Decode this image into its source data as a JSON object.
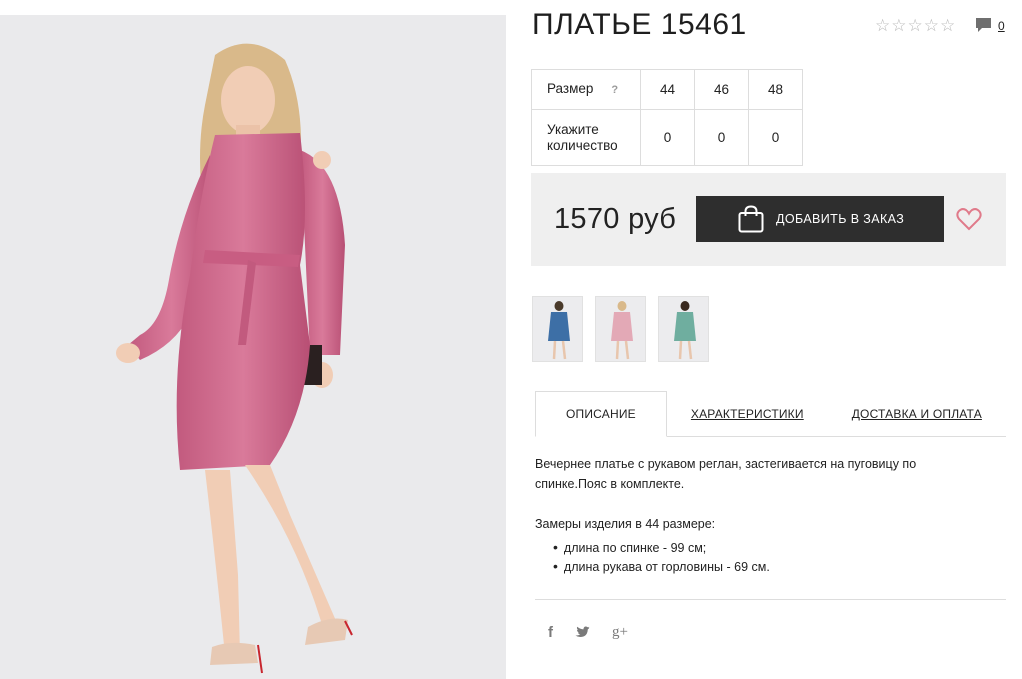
{
  "product": {
    "title": "ПЛАТЬЕ 15461",
    "rating_stars": 5,
    "rating_value": 0,
    "comments_count": "0",
    "price": "1570 руб",
    "add_to_order_label": "ДОБАВИТЬ В ЗАКАЗ",
    "accent_color": "#e07a8a"
  },
  "size_table": {
    "size_label": "Размер",
    "help_mark": "?",
    "qty_label": "Укажите количество",
    "sizes": [
      "44",
      "46",
      "48"
    ],
    "quantities": [
      "0",
      "0",
      "0"
    ]
  },
  "thumbnails": [
    {
      "color_name": "blue",
      "color": "#3d6fa6"
    },
    {
      "color_name": "pink",
      "color": "#e3a9b6"
    },
    {
      "color_name": "mint",
      "color": "#6fae9f"
    }
  ],
  "tabs": [
    {
      "label": "ОПИСАНИЕ",
      "active": true
    },
    {
      "label": "ХАРАКТЕРИСТИКИ",
      "active": false
    },
    {
      "label": "ДОСТАВКА И ОПЛАТА",
      "active": false
    }
  ],
  "description": {
    "text": "Вечернее платье с рукавом реглан, застегивается на пуговицу по спинке.Пояс в комплекте.",
    "measure_title": "Замеры изделия в 44 размере:",
    "measures": [
      "длина по спинке - 99 см;",
      "длина рукава от горловины - 69 см."
    ]
  },
  "social": {
    "facebook": "f",
    "twitter": "t",
    "google_plus": "g+"
  }
}
